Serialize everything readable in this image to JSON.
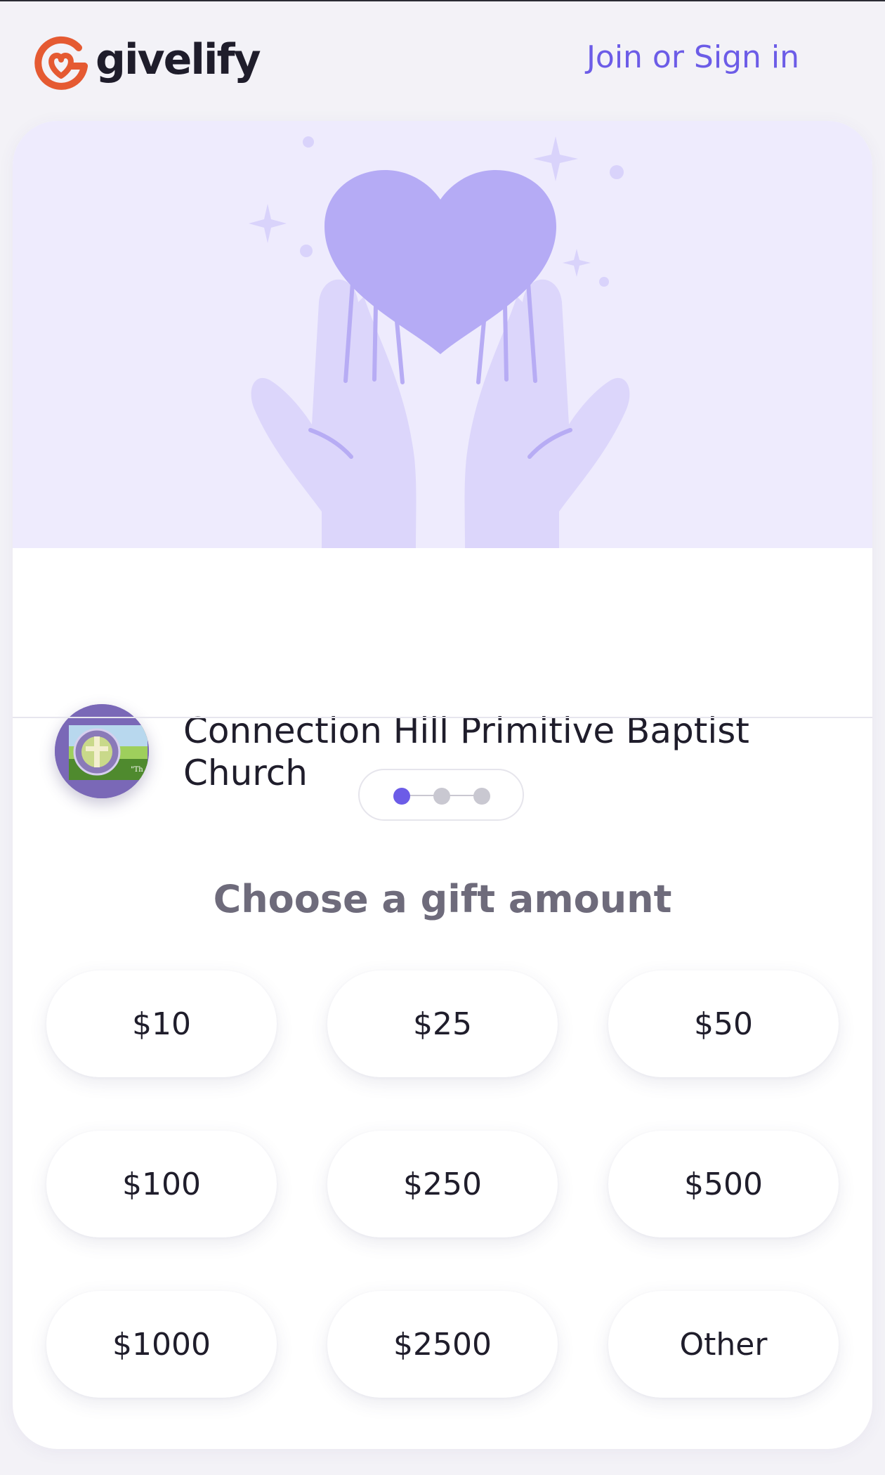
{
  "brand": {
    "name": "givelify",
    "logo_icon": "givelify-heart-g-icon",
    "accent_color": "#6c5ce7",
    "logo_color": "#e55a32"
  },
  "header": {
    "signin_label": "Join or Sign in"
  },
  "hero": {
    "illustration": "hands-holding-heart-icon"
  },
  "organization": {
    "name": "Connection Hill Primitive Baptist Church",
    "avatar": "church-logo-avatar"
  },
  "stepper": {
    "current_step": 1,
    "total_steps": 3
  },
  "gift": {
    "heading": "Choose a gift amount",
    "amounts": [
      "$10",
      "$25",
      "$50",
      "$100",
      "$250",
      "$500",
      "$1000",
      "$2500",
      "Other"
    ]
  }
}
